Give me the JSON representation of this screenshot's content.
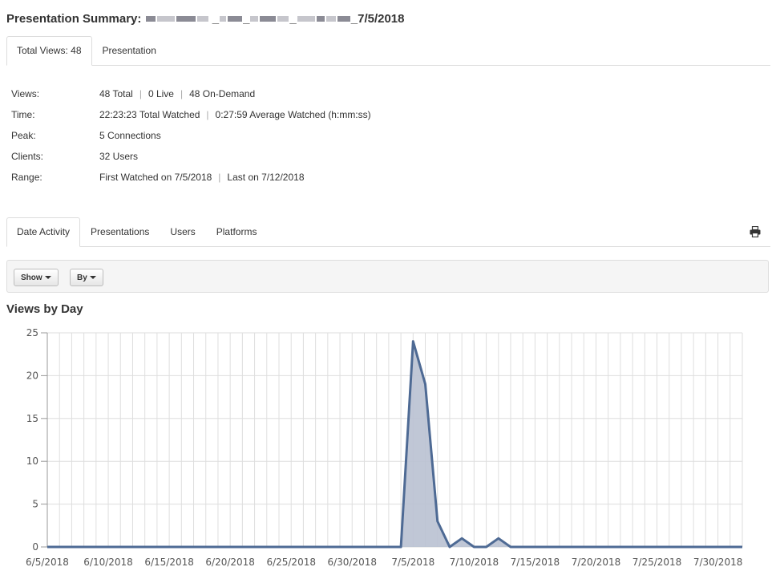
{
  "header": {
    "title_prefix": "Presentation Summary:",
    "title_suffix": "_7/5/2018"
  },
  "top_tabs": [
    {
      "label": "Total Views: 48",
      "active": true
    },
    {
      "label": "Presentation",
      "active": false
    }
  ],
  "stats": [
    {
      "label": "Views:",
      "parts": [
        "48 Total",
        "0 Live",
        "48 On-Demand"
      ]
    },
    {
      "label": "Time:",
      "parts": [
        "22:23:23 Total Watched",
        "0:27:59 Average Watched (h:mm:ss)"
      ]
    },
    {
      "label": "Peak:",
      "parts": [
        "5 Connections"
      ]
    },
    {
      "label": "Clients:",
      "parts": [
        "32 Users"
      ]
    },
    {
      "label": "Range:",
      "parts": [
        "First Watched on 7/5/2018",
        "Last on 7/12/2018"
      ]
    }
  ],
  "report_tabs": [
    {
      "label": "Date Activity",
      "active": true
    },
    {
      "label": "Presentations",
      "active": false
    },
    {
      "label": "Users",
      "active": false
    },
    {
      "label": "Platforms",
      "active": false
    }
  ],
  "toolbar": {
    "show_label": "Show",
    "by_label": "By"
  },
  "chart_title": "Views by Day",
  "chart_data": {
    "type": "area",
    "title": "Views by Day",
    "xlabel": "",
    "ylabel": "",
    "ylim": [
      0,
      25
    ],
    "yticks": [
      0,
      5,
      10,
      15,
      20,
      25
    ],
    "x_start": "6/5/2018",
    "x_end": "8/1/2018",
    "xtick_labels": [
      "6/5/2018",
      "6/10/2018",
      "6/15/2018",
      "6/20/2018",
      "6/25/2018",
      "6/30/2018",
      "7/5/2018",
      "7/10/2018",
      "7/15/2018",
      "7/20/2018",
      "7/25/2018",
      "7/30/2018"
    ],
    "grid": true,
    "series": [
      {
        "color": "#4e6a94",
        "fill": "#b9c1d1",
        "points": [
          {
            "x": "7/4/2018",
            "y": 0
          },
          {
            "x": "7/5/2018",
            "y": 24
          },
          {
            "x": "7/6/2018",
            "y": 19
          },
          {
            "x": "7/7/2018",
            "y": 3
          },
          {
            "x": "7/8/2018",
            "y": 0
          },
          {
            "x": "7/9/2018",
            "y": 1
          },
          {
            "x": "7/10/2018",
            "y": 0
          },
          {
            "x": "7/11/2018",
            "y": 0
          },
          {
            "x": "7/12/2018",
            "y": 1
          },
          {
            "x": "7/13/2018",
            "y": 0
          }
        ]
      }
    ]
  },
  "colors": {
    "series_line": "#4e6a94",
    "series_fill": "#b9c1d1",
    "grid": "#dedede",
    "tab_border": "#dddddd"
  }
}
